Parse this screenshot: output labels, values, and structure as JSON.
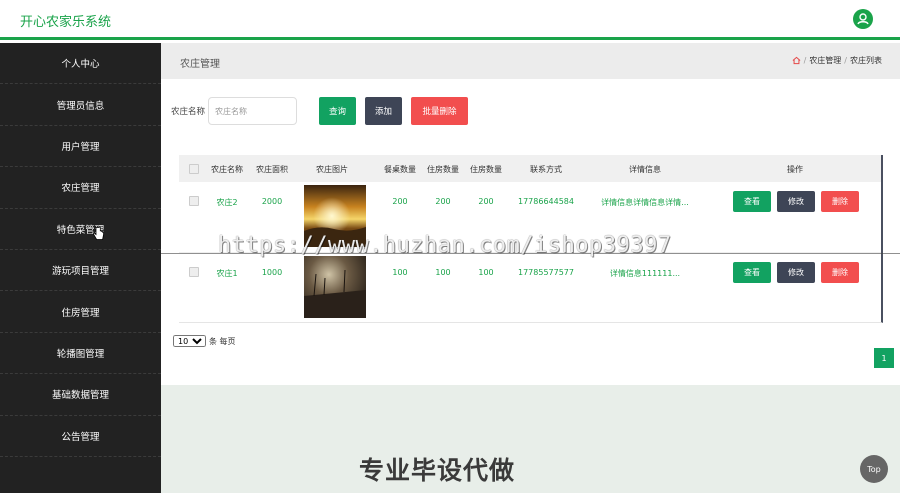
{
  "app": {
    "title": "开心农家乐系统",
    "accent": "#1aa34a"
  },
  "sidebar": {
    "items": [
      {
        "label": "个人中心"
      },
      {
        "label": "管理员信息"
      },
      {
        "label": "用户管理"
      },
      {
        "label": "农庄管理"
      },
      {
        "label": "特色菜管理"
      },
      {
        "label": "游玩项目管理"
      },
      {
        "label": "住房管理"
      },
      {
        "label": "轮播图管理"
      },
      {
        "label": "基础数据管理"
      },
      {
        "label": "公告管理"
      }
    ]
  },
  "page": {
    "title": "农庄管理",
    "breadcrumb": [
      "农庄管理",
      "农庄列表"
    ]
  },
  "search": {
    "label": "农庄名称",
    "placeholder": "农庄名称",
    "query_label": "查询",
    "add_label": "添加",
    "batch_delete_label": "批量删除"
  },
  "table": {
    "columns": [
      "农庄名称",
      "农庄面积",
      "农庄图片",
      "餐桌数量",
      "住房数量",
      "住房数量",
      "联系方式",
      "详情信息",
      "操作"
    ],
    "rows": [
      {
        "name": "农庄2",
        "area": "2000",
        "image": "sunset-farm-photo",
        "tables": "200",
        "rooms": "200",
        "rooms2": "200",
        "phone": "17786644584",
        "detail": "详情信息详情信息详情..."
      },
      {
        "name": "农庄1",
        "area": "1000",
        "image": "dusk-field-photo",
        "tables": "100",
        "rooms": "100",
        "rooms2": "100",
        "phone": "17785577577",
        "detail": "详情信息111111..."
      }
    ],
    "actions": {
      "view": "查看",
      "edit": "修改",
      "delete": "删除"
    }
  },
  "pagination": {
    "page_size": "10",
    "per_page_suffix": "条 每页",
    "current_page": "1"
  },
  "overlay": {
    "watermark": "https://www.huzhan.com/ishop39397",
    "promo": "专业毕设代做",
    "top_button": "Top"
  }
}
